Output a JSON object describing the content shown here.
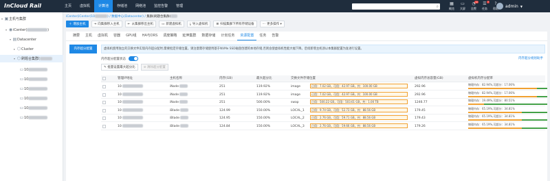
{
  "app": {
    "logo": "InCloud Rail"
  },
  "nav": [
    "主页",
    "虚拟机",
    "计算池",
    "存储池",
    "网络池",
    "监控告警",
    "管理"
  ],
  "nav_active": 2,
  "topbar": {
    "tools": [
      {
        "label": "概览",
        "icon": "grid-icon",
        "glyph": "▦",
        "badge": ""
      },
      {
        "label": "大屏",
        "icon": "screen-icon",
        "glyph": "▭",
        "badge": ""
      },
      {
        "label": "告警",
        "icon": "bell-icon",
        "glyph": "◔",
        "badge": "10"
      },
      {
        "label": "任务",
        "icon": "task-icon",
        "glyph": "☰",
        "badge": "7"
      },
      {
        "label": "帮助",
        "icon": "help-icon",
        "glyph": "?",
        "badge": ""
      }
    ],
    "user": "admin"
  },
  "tree": {
    "root": "主机与集群",
    "vcenter": "iCenter(",
    "datacenter": "Datacenter",
    "cluster": "Cluster",
    "selected": "刷题合集群(",
    "hosts": [
      "10",
      "10",
      "10",
      "10",
      "10",
      "10"
    ]
  },
  "breadcrumb": {
    "path": "iCenter(iCenter(10",
    "path2": ") / 数据中心(Datacenter) / ",
    "current": "集群(刷题合集群("
  },
  "actions": [
    "增加主机",
    "向集群移入主机",
    "从集群移出主机",
    "新建虚拟机",
    "导入虚拟机",
    "扫描集群下所有存储设备",
    "更多操作"
  ],
  "tabs": [
    "摘要",
    "主机",
    "虚拟机",
    "容器",
    "GPU组",
    "HA与DRS",
    "调度策略",
    "延伸集群",
    "数据存储",
    "计划任务",
    "资源配置",
    "任务",
    "告警"
  ],
  "tabs_active": 10,
  "side_tab": "内存超分配置",
  "note": "虚拟机使用独立的交换文件实现内存超分配时,需要指定存储位置。请注意需存储使用基于NVMe SSD磁盘创建的本地存储,否则会使虚拟机性能大幅下降。后续新增主机须以本集群配置为准进行设置。",
  "switch_label": "内存超分配置状态",
  "help_link": "内存超分规划助手",
  "buttons": {
    "batch": "批量设置最大超分比",
    "clear": "清除超分配置"
  },
  "columns": [
    "管理IP地址",
    "主机名称",
    "内存(GB)",
    "最大超分比",
    "交换文件存储位置",
    "虚拟内存总容量(GB)",
    "虚拟机内存分配率"
  ],
  "rows": [
    {
      "ip": "10",
      "host": "iNode",
      "mem": "251",
      "ratio": "119.92%",
      "store": "image",
      "usage": "已用：7.02 GB，可用：42.97 GB，共：100.00 GB",
      "total": "292.96",
      "alloc": "物理内存：82.94%,可超分：17.06%",
      "phys": 82.94
    },
    {
      "ip": "10",
      "host": "iNode",
      "mem": "251",
      "ratio": "119.92%",
      "store": "image",
      "usage": "已用：7.02 GB，可用：42.97 GB，共：100.00 GB",
      "total": "292.96",
      "alloc": "物理内存：82.94%,可超分：17.06%",
      "phys": 82.94
    },
    {
      "ip": "10",
      "host": "iNode",
      "mem": "251",
      "ratio": "500.00%",
      "store": "swap",
      "usage": "已用：500.22 GB，可用：503.61 GB，共：1.00 TB",
      "total": "1246.77",
      "alloc": "物理内存：19.49%,可超分：80.51%",
      "phys": 19.49
    },
    {
      "ip": "10",
      "host": "iBlade",
      "mem": "124.99",
      "ratio": "150.00%",
      "store": "LOCAL_1",
      "usage": "已用：9.74 GB，可用：52.73 GB，共：88.56 GB",
      "total": "179.45",
      "alloc": "物理内存：65.19%,可超分：34.81%",
      "phys": 65.19
    },
    {
      "ip": "10",
      "host": "iBlade",
      "mem": "124.95",
      "ratio": "150.00%",
      "store": "LOCAL_2",
      "usage": "已用：2.76 GB，可用：59.71 GB，共：88.56 GB",
      "total": "179.43",
      "alloc": "物理内存：65.19%,可超分：34.81%",
      "phys": 65.19
    },
    {
      "ip": "10",
      "host": "iBlade",
      "mem": "124.84",
      "ratio": "150.00%",
      "store": "LOCAL_3",
      "usage": "已用：2.76 GB，可用：59.66 GB，共：88.56 GB",
      "total": "179.26",
      "alloc": "物理内存：65.19%,可超分：34.81%",
      "phys": 65.19
    }
  ],
  "colors": {
    "accent": "#1e88e5",
    "topbar": "#1f2d3d",
    "warn": "#f0a030",
    "ok": "#43a047"
  }
}
